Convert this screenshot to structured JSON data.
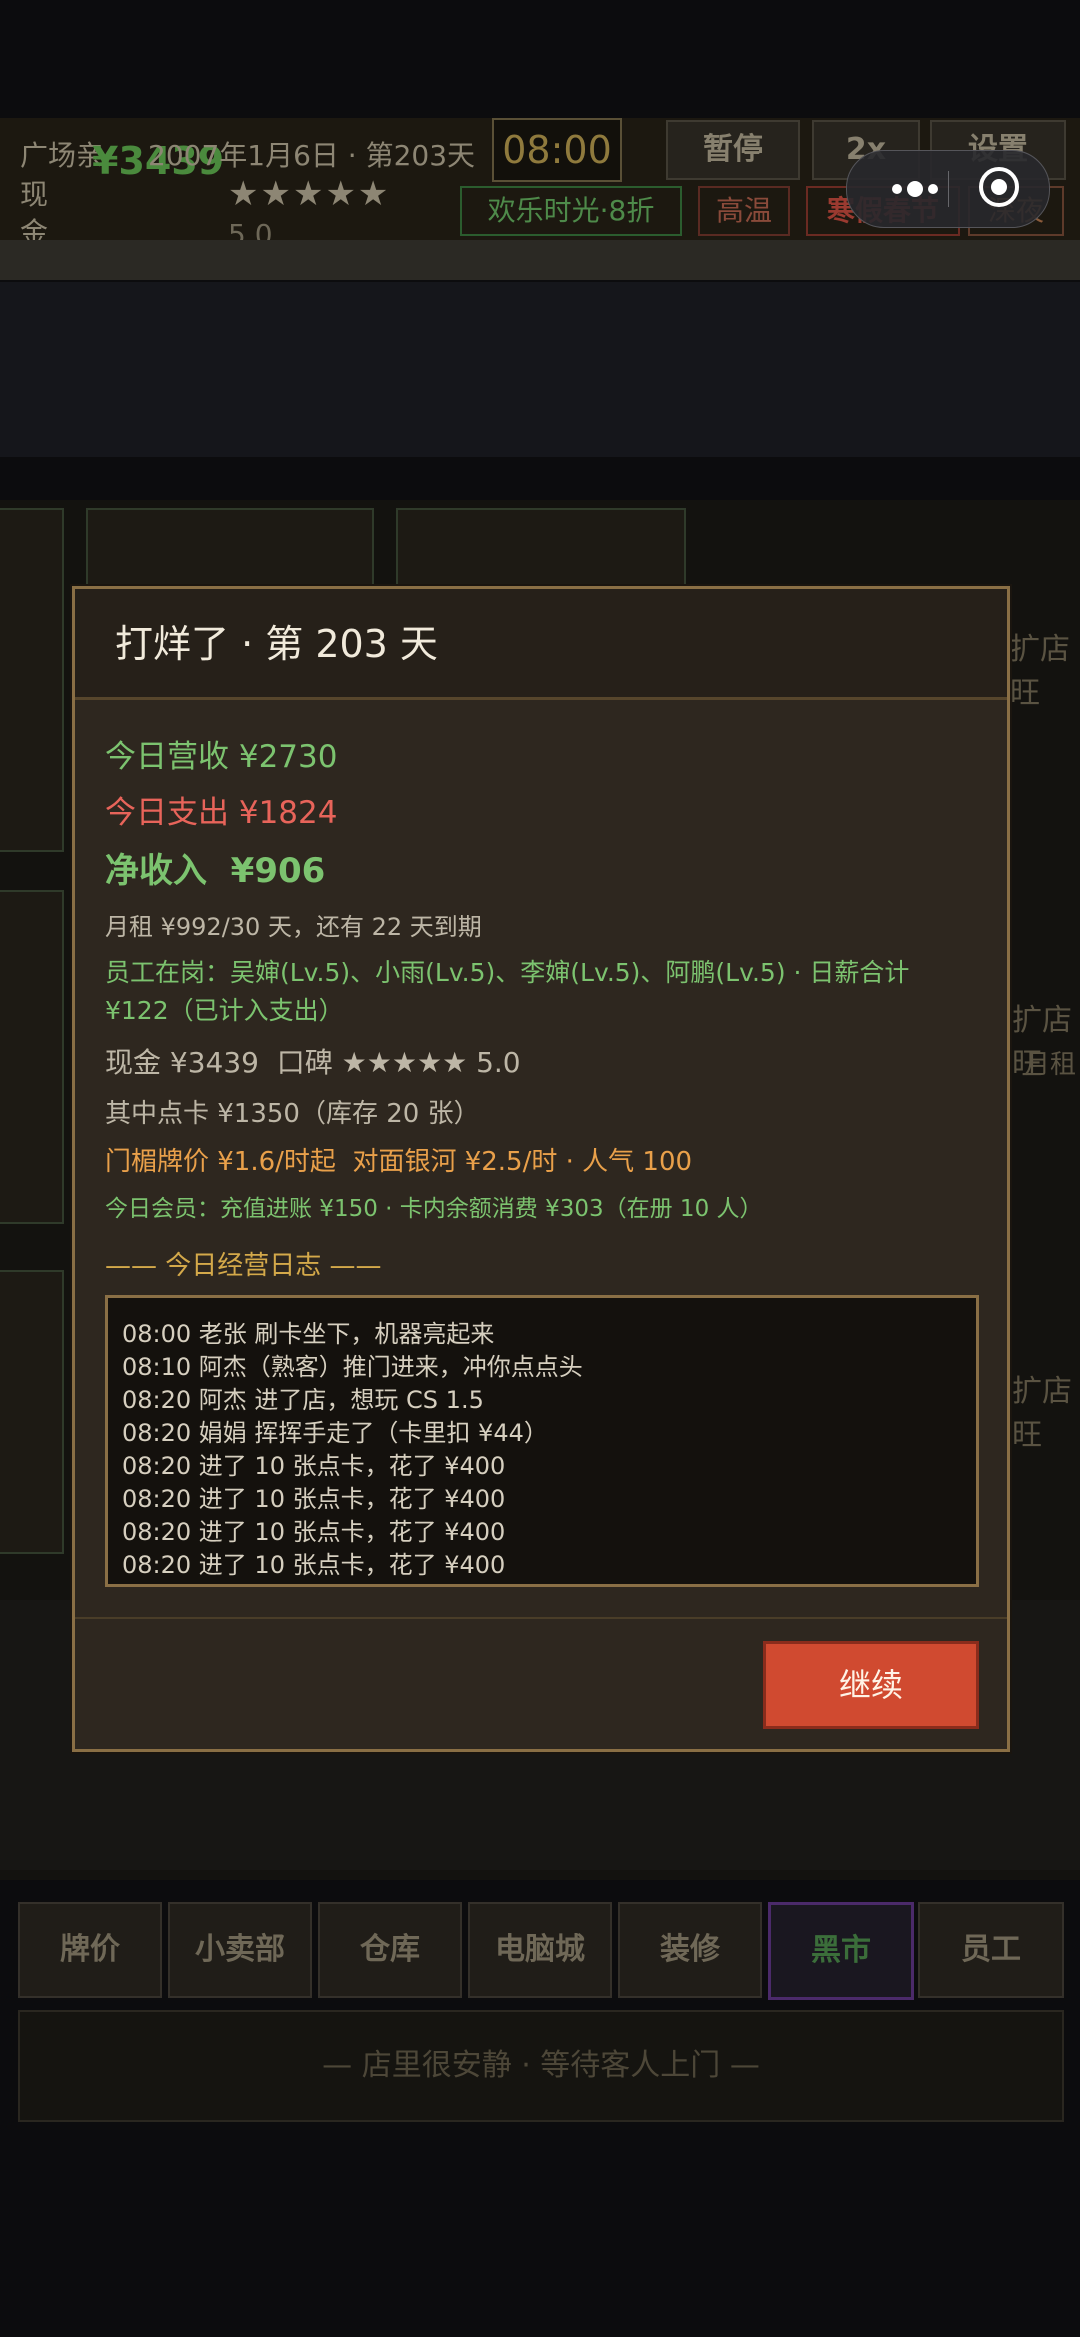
{
  "topbar": {
    "shop": "广场亲",
    "cash_label": "现金",
    "cash_value": "¥3439",
    "date": "2007年1月6日 · 第203天",
    "stars": "★★★★★",
    "rating": "5.0",
    "clock": "08:00",
    "pause": "暂停",
    "speed": "2x",
    "settings": "设置",
    "tags": [
      "欢乐时光·8折",
      "高温",
      "寒假春节",
      "深夜"
    ]
  },
  "side_panels": {
    "expand_label": "扩店旺",
    "rent_label": "月租"
  },
  "modal": {
    "title": "打烊了 · 第 203 天",
    "revenue": "今日营收 ¥2730",
    "expense": "今日支出 ¥1824",
    "net": "净收入  ¥906",
    "rent": "月租 ¥992/30 天，还有 22 天到期",
    "staff": "员工在岗：吴婶(Lv.5)、小雨(Lv.5)、李婶(Lv.5)、阿鹏(Lv.5) · 日薪合计",
    "staff_2": "¥122（已计入支出）",
    "cash_rep": "现金 ¥3439  口碑 ★★★★★ 5.0",
    "cards": "其中点卡 ¥1350（库存 20 张）",
    "price": "门楣牌价 ¥1.6/时起  对面银河 ¥2.5/时 · 人气 100",
    "members": "今日会员：充值进账 ¥150 · 卡内余额消费 ¥303（在册 10 人）",
    "log_title": "—— 今日经营日志 ——",
    "log": [
      "08:00 老张 刷卡坐下，机器亮起来",
      "08:10 阿杰（熟客）推门进来，冲你点点头",
      "08:20 阿杰 进了店，想玩 CS 1.5",
      "08:20 娟娟 挥挥手走了（卡里扣 ¥44）",
      "08:20 进了 10 张点卡，花了 ¥400",
      "08:20 进了 10 张点卡，花了 ¥400",
      "08:20 进了 10 张点卡，花了 ¥400",
      "08:20 进了 10 张点卡，花了 ¥400"
    ],
    "continue": "继续"
  },
  "nav": [
    "牌价",
    "小卖部",
    "仓库",
    "电脑城",
    "装修",
    "黑市",
    "员工"
  ],
  "nav_active": "黑市",
  "status": "— 店里很安静 · 等待客人上门 —",
  "colors": {
    "income": "#7cc36f",
    "expense": "#e8645a",
    "accent": "#d04a30",
    "border": "#8a6f45"
  }
}
